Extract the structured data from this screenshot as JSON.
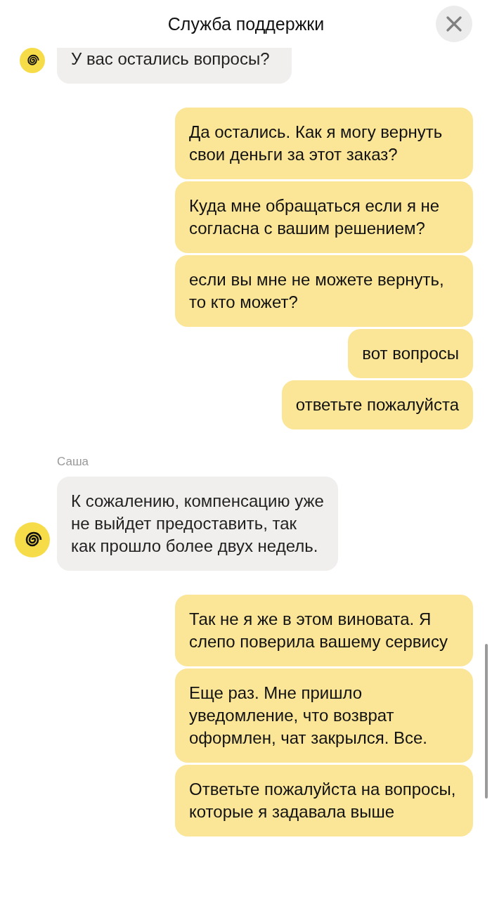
{
  "header": {
    "title": "Служба поддержки"
  },
  "groups": [
    {
      "kind": "incoming",
      "messages": [
        "У вас остались вопросы?"
      ]
    },
    {
      "kind": "outgoing",
      "messages": [
        "Да остались. Как я могу вернуть свои деньги за этот заказ?",
        "Куда мне обращаться если я не согласна с вашим решением?",
        "если вы мне не можете вернуть, то кто может?",
        "вот вопросы",
        "ответьте пожалуйста"
      ]
    },
    {
      "kind": "incoming",
      "sender": "Саша",
      "messages": [
        "К сожалению, компенсацию уже не выйдет предоставить, так как прошло более двух недель."
      ]
    },
    {
      "kind": "outgoing",
      "messages": [
        "Так не я же в этом виновата. Я слепо поверила вашему сервису",
        "Еще раз. Мне пришло уведомление, что возврат оформлен, чат закрылся. Все.",
        "Ответьте пожалуйста на вопросы, которые я задавала выше"
      ]
    }
  ]
}
